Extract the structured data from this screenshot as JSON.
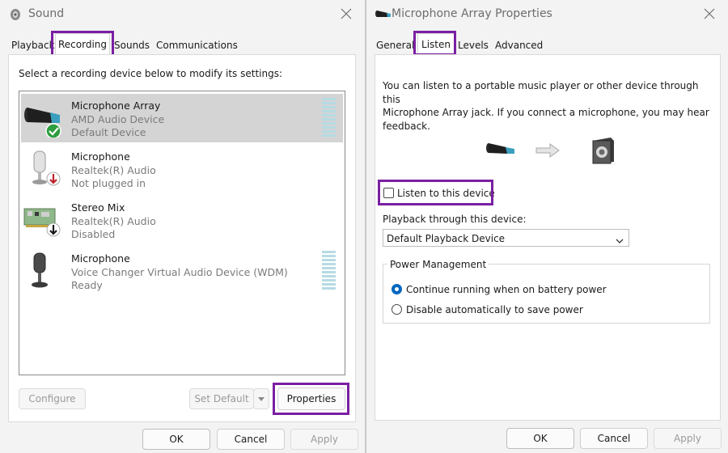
{
  "sound": {
    "title": "Sound",
    "tabs": [
      "Playback",
      "Recording",
      "Sounds",
      "Communications"
    ],
    "instruction": "Select a recording device below to modify its settings:",
    "devices": [
      {
        "name": "Microphone Array",
        "driver": "AMD Audio Device",
        "status": "Default Device",
        "selected": true
      },
      {
        "name": "Microphone",
        "driver": "Realtek(R) Audio",
        "status": "Not plugged in",
        "selected": false
      },
      {
        "name": "Stereo Mix",
        "driver": "Realtek(R) Audio",
        "status": "Disabled",
        "selected": false
      },
      {
        "name": "Microphone",
        "driver": "Voice Changer Virtual Audio Device (WDM)",
        "status": "Ready",
        "selected": false
      }
    ],
    "buttons": {
      "configure": "Configure",
      "set_default": "Set Default",
      "properties": "Properties",
      "ok": "OK",
      "cancel": "Cancel",
      "apply": "Apply"
    }
  },
  "props": {
    "title": "Microphone Array Properties",
    "tabs": [
      "General",
      "Listen",
      "Levels",
      "Advanced"
    ],
    "description": [
      "You can listen to a portable music player or other device through this",
      "Microphone Array jack.  If you connect a microphone, you may hear",
      "feedback."
    ],
    "listen_checkbox": {
      "label": "Listen to this device",
      "checked": false
    },
    "playback_label": "Playback through this device:",
    "playback_value": "Default Playback Device",
    "power_group": "Power Management",
    "power_options": [
      {
        "label": "Continue running when on battery power",
        "selected": true
      },
      {
        "label": "Disable automatically to save power",
        "selected": false
      }
    ],
    "buttons": {
      "ok": "OK",
      "cancel": "Cancel",
      "apply": "Apply"
    }
  },
  "colors": {
    "highlight": "#7a1fa2",
    "accent": "#0067c0",
    "level_meter": "#b6dbe4"
  }
}
